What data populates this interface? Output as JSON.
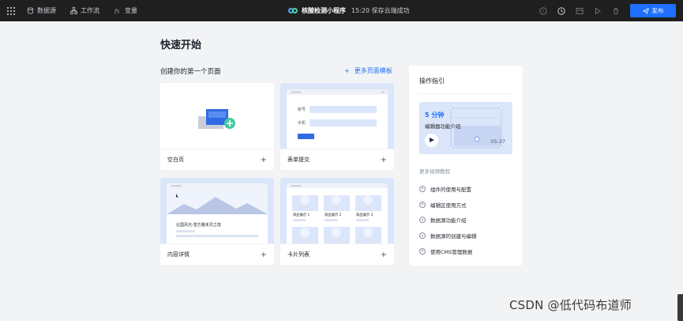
{
  "topbar": {
    "nav": [
      {
        "label": "数据源",
        "icon": "database-icon"
      },
      {
        "label": "工作流",
        "icon": "workflow-icon"
      },
      {
        "label": "变量",
        "icon": "fx-icon"
      }
    ],
    "app_title": "核酸检测小程序",
    "save_status": "15:20 保存云端成功",
    "right_icons": [
      "help-icon",
      "history-icon",
      "preview-box-icon",
      "run-icon",
      "delete-icon"
    ],
    "publish_label": "发布"
  },
  "main": {
    "page_title": "快速开始",
    "section_title": "创建你的第一个页面",
    "more_templates": "更多页面模板",
    "templates": [
      {
        "label": "空白页"
      },
      {
        "label": "表单提交"
      },
      {
        "label": "内容详情"
      },
      {
        "label": "卡片列表"
      }
    ],
    "form_preview": {
      "field1": "账号",
      "field2": "手机"
    },
    "detail_preview": {
      "headline": "北国风光-雪方雅未灵之境"
    },
    "cards_preview": {
      "items": [
        "商品展示 1",
        "商品展示 2",
        "商品展示 3"
      ]
    }
  },
  "guide": {
    "title": "操作指引",
    "video": {
      "minutes": "5 分钟",
      "desc": "编辑器功能介绍",
      "duration": "05:37"
    },
    "more_videos_label": "更多视频教程",
    "items": [
      "组件的使用与配置",
      "编辑区使用方式",
      "数据源功能介绍",
      "数据源的创建与编辑",
      "使用CMS管理数据"
    ]
  },
  "watermark": "CSDN @低代码布道师",
  "colors": {
    "accent": "#1e6fff",
    "topbar": "#1f1f1f",
    "background": "#f2f3f5"
  }
}
